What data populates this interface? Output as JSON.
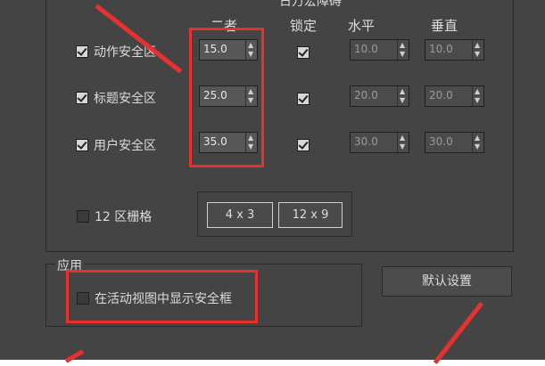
{
  "group": {
    "title": "日万宏障碍"
  },
  "columns": {
    "both": "二者",
    "lock": "锁定",
    "horizontal": "水平",
    "vertical": "垂直"
  },
  "rows": [
    {
      "label": "动作安全区",
      "checked": true,
      "both": "15.0",
      "locked": true,
      "horizontal": "10.0",
      "vertical": "10.0"
    },
    {
      "label": "标题安全区",
      "checked": true,
      "both": "25.0",
      "locked": true,
      "horizontal": "20.0",
      "vertical": "20.0"
    },
    {
      "label": "用户安全区",
      "checked": true,
      "both": "35.0",
      "locked": true,
      "horizontal": "30.0",
      "vertical": "30.0"
    }
  ],
  "grid": {
    "label": "12 区栅格",
    "checked": false,
    "btn_4x3": "4 x 3",
    "btn_12x9": "12 x 9"
  },
  "apply": {
    "title": "应用",
    "label": "在活动视图中显示安全框",
    "checked": false
  },
  "default_button": "默认设置",
  "colors": {
    "dialog_bg": "#444444",
    "highlight": "#e8312f",
    "text": "#dcdcdc"
  }
}
